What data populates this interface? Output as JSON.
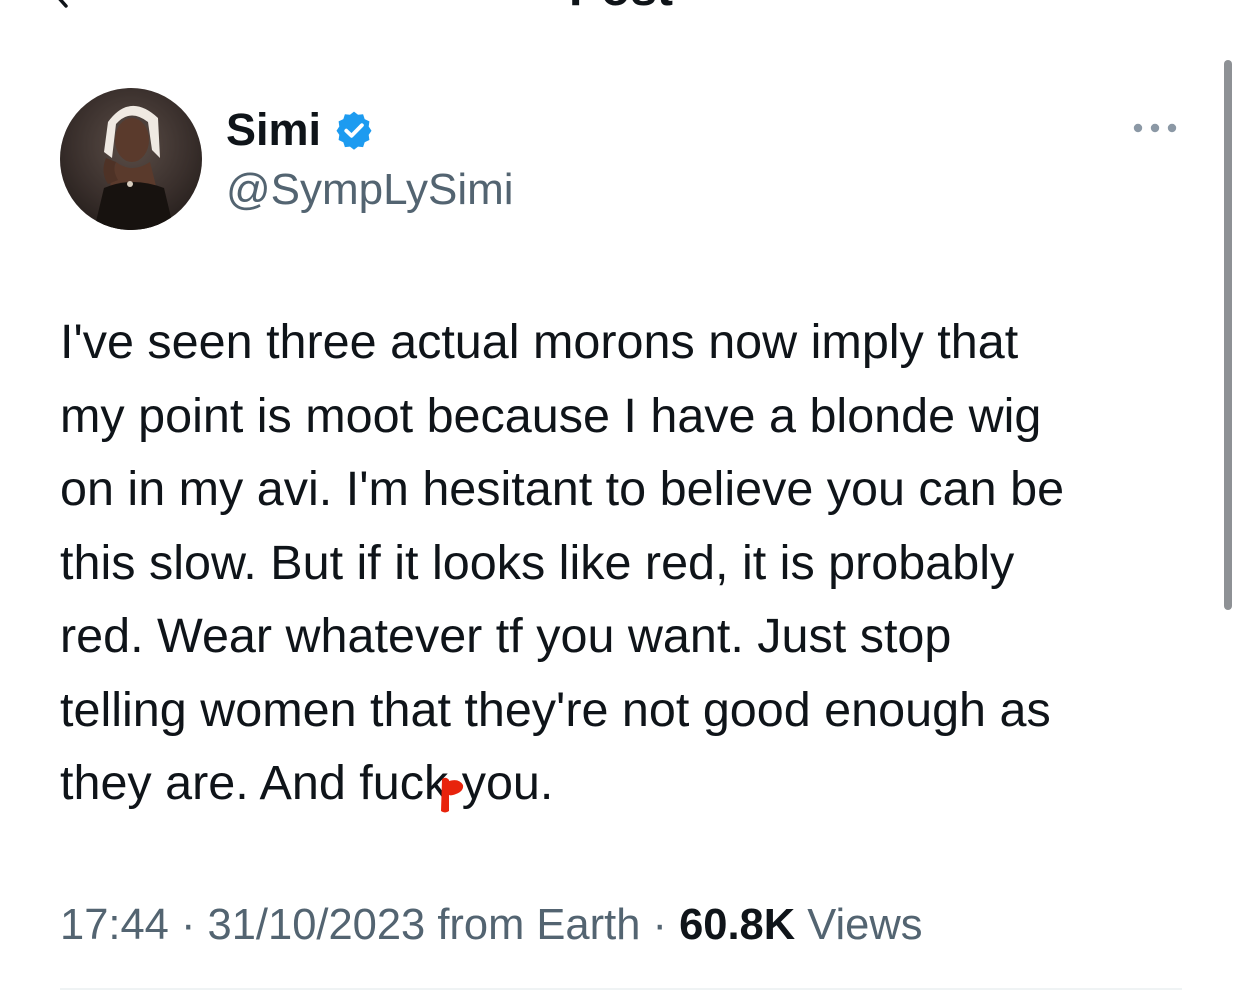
{
  "header": {
    "title": "Post",
    "back_icon": "arrow-left-icon"
  },
  "author": {
    "display_name": "Simi",
    "handle": "@SympLySimi",
    "verified": true,
    "verified_icon": "verified-badge-icon",
    "verified_color": "#1d9bf0",
    "avatar_icon": "profile-photo"
  },
  "more_options_icon": "more-horizontal-icon",
  "tweet": {
    "lines": [
      "I've seen three actual morons now imply that",
      "my point is moot because I have a blonde wig",
      "on in my avi. I'm hesitant to believe you can be",
      "this slow. But if it looks like red, it is probably",
      "red. Wear whatever tf you want. Just stop",
      "telling women that they're not good enough as",
      "they are. And fuck you."
    ],
    "censor_mark_color": "#e8230c"
  },
  "meta": {
    "time": "17:44",
    "separator": " · ",
    "date": "31/10/2023",
    "location": " from Earth",
    "views_count": "60.8K",
    "views_label": " Views"
  },
  "colors": {
    "text_primary": "#0f1419",
    "text_secondary": "#536471",
    "divider": "#eff3f4"
  }
}
